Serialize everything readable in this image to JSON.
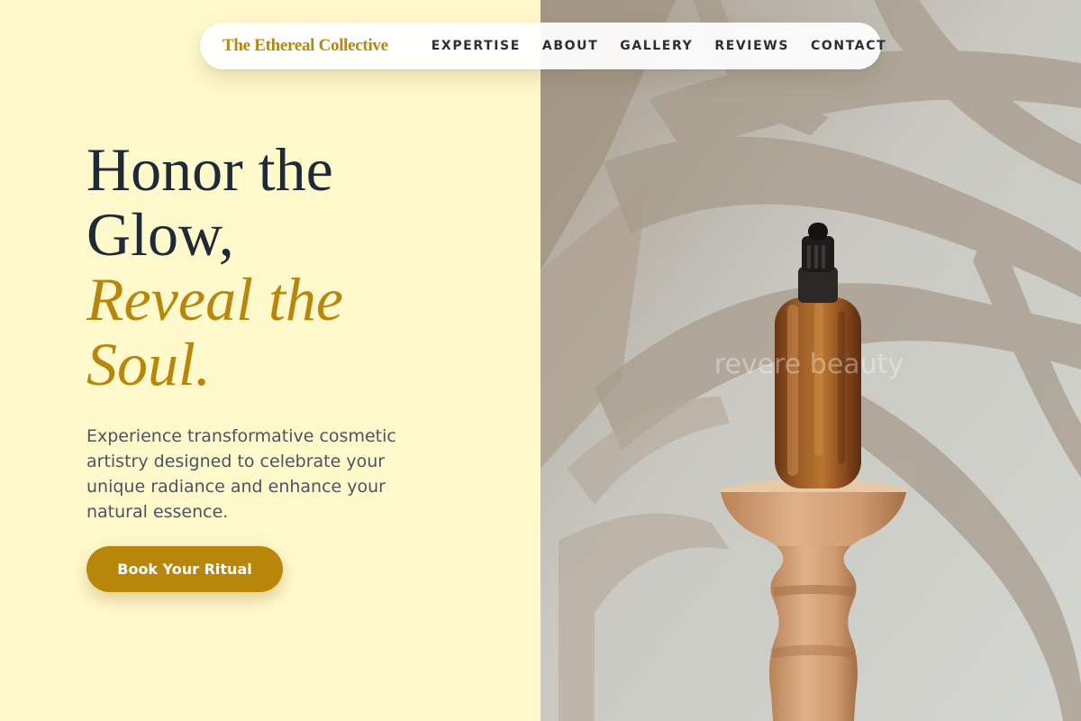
{
  "brand": {
    "name": "The Ethereal Collective"
  },
  "nav": {
    "items": [
      {
        "label": "EXPERTISE"
      },
      {
        "label": "ABOUT"
      },
      {
        "label": "GALLERY"
      },
      {
        "label": "REVIEWS"
      },
      {
        "label": "CONTACT"
      }
    ]
  },
  "hero": {
    "title_line1": "Honor the",
    "title_line2": "Glow,",
    "title_accent1": "Reveal the",
    "title_accent2": "Soul.",
    "description": "Experience transformative cosmetic artistry designed to celebrate your unique radiance and enhance your natural essence.",
    "cta_label": "Book Your Ritual"
  },
  "image": {
    "watermark": "revere beauty"
  },
  "colors": {
    "background": "#FFF9CC",
    "accent": "#B8860B",
    "heading": "#1F2A37",
    "body_text": "#4B5460"
  }
}
